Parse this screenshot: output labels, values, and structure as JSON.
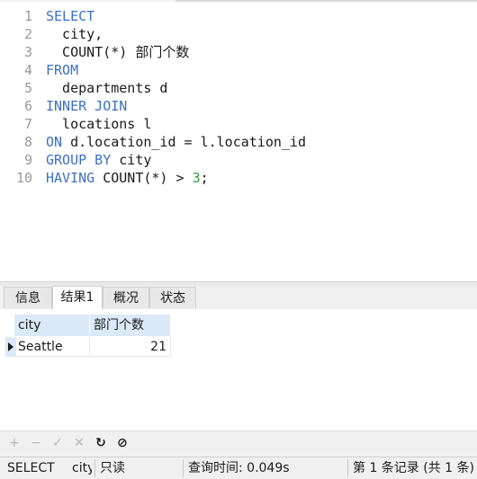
{
  "editor": {
    "lines": [
      {
        "n": "1",
        "parts": [
          {
            "t": "SELECT",
            "c": "kw"
          }
        ]
      },
      {
        "n": "2",
        "parts": [
          {
            "t": "  city,",
            "c": ""
          }
        ]
      },
      {
        "n": "3",
        "parts": [
          {
            "t": "  COUNT(*) 部门个数",
            "c": ""
          }
        ]
      },
      {
        "n": "4",
        "parts": [
          {
            "t": "FROM",
            "c": "kw"
          }
        ]
      },
      {
        "n": "5",
        "parts": [
          {
            "t": "  departments d",
            "c": ""
          }
        ]
      },
      {
        "n": "6",
        "parts": [
          {
            "t": "INNER JOIN",
            "c": "kw"
          }
        ]
      },
      {
        "n": "7",
        "parts": [
          {
            "t": "  locations l",
            "c": ""
          }
        ]
      },
      {
        "n": "8",
        "parts": [
          {
            "t": "ON",
            "c": "kw"
          },
          {
            "t": " d.location_id = l.location_id",
            "c": ""
          }
        ]
      },
      {
        "n": "9",
        "parts": [
          {
            "t": "GROUP BY",
            "c": "kw"
          },
          {
            "t": " city",
            "c": ""
          }
        ]
      },
      {
        "n": "10",
        "parts": [
          {
            "t": "HAVING",
            "c": "kw"
          },
          {
            "t": " COUNT(*) > ",
            "c": ""
          },
          {
            "t": "3",
            "c": "num"
          },
          {
            "t": ";",
            "c": ""
          }
        ]
      }
    ]
  },
  "tabs": [
    {
      "label": "信息",
      "active": false
    },
    {
      "label": "结果1",
      "active": true
    },
    {
      "label": "概况",
      "active": false
    },
    {
      "label": "状态",
      "active": false
    }
  ],
  "results": {
    "columns": [
      "city",
      "部门个数"
    ],
    "rows": [
      [
        "Seattle",
        "21"
      ]
    ]
  },
  "toolbar": {
    "add": "+",
    "remove": "−",
    "apply": "✓",
    "discard": "✕",
    "refresh": "↻",
    "stop": "⊘"
  },
  "status": {
    "query": "SELECT",
    "query_tail": "city",
    "readonly": "只读",
    "query_time": "查询时间: 0.049s",
    "record": "第 1 条记录 (共 1 条)"
  }
}
